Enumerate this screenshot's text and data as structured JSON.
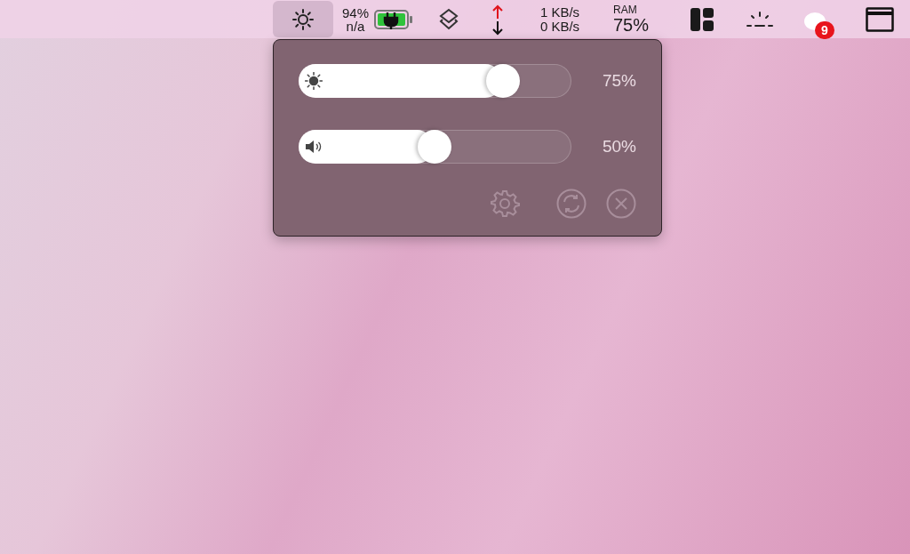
{
  "menu_bar": {
    "items": [
      {
        "kind": "brightness",
        "selected": true
      },
      {
        "kind": "battery",
        "percent": "94%",
        "status": "n/a",
        "selected": false
      },
      {
        "kind": "layers",
        "selected": false
      },
      {
        "kind": "arrows",
        "selected": false
      },
      {
        "kind": "network",
        "upload": "1 KB/s",
        "download": "0 KB/s",
        "selected": false
      },
      {
        "kind": "ram",
        "label": "RAM",
        "value": "75%",
        "selected": false
      },
      {
        "kind": "layout",
        "selected": false
      },
      {
        "kind": "sunrise",
        "selected": false
      },
      {
        "kind": "notifications",
        "badge": "9",
        "selected": false
      },
      {
        "kind": "window",
        "selected": false
      }
    ]
  },
  "popup": {
    "sliders": [
      {
        "kind": "brightness",
        "level": 0.75,
        "reading": "75%"
      },
      {
        "kind": "volume",
        "level": 0.5,
        "reading": "50%"
      }
    ],
    "buttons": [
      {
        "kind": "settings"
      },
      {
        "kind": "refresh"
      },
      {
        "kind": "close"
      }
    ]
  }
}
